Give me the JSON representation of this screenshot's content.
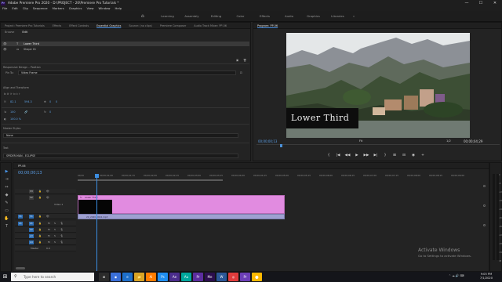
{
  "window": {
    "title": "Adobe Premiere Pro 2020 - D:\\PROJECT - 20\\Premiere Pro Tutorials *",
    "logo": "Pr",
    "controls": [
      "—",
      "☐",
      "✕"
    ]
  },
  "menu": [
    "File",
    "Edit",
    "Clip",
    "Sequence",
    "Markers",
    "Graphics",
    "View",
    "Window",
    "Help"
  ],
  "workspaces": [
    "Learning",
    "Assembly",
    "Editing",
    "Color",
    "Effects",
    "Audio",
    "Graphics",
    "Libraries",
    "»"
  ],
  "eg_panel": {
    "tabs": [
      "Project: Premiere Pro Tutorials",
      "Effects",
      "Effect Controls",
      "Essential Graphics",
      "Source: (no clips)",
      "Premiere Composer",
      "Audio Track Mixer: PP-06"
    ],
    "active_tab_index": 3,
    "subtabs": [
      "Browse",
      "Edit"
    ],
    "active_subtab_index": 1,
    "layers": [
      {
        "name": "Lower Third",
        "selected": true
      },
      {
        "name": "Shape 01",
        "selected": false
      }
    ],
    "responsive_label": "Responsive Design – Position",
    "pin_to_label": "Pin To:",
    "pin_to_value": "Video Frame",
    "align_label": "Align and Transform",
    "pos_x": "82.1",
    "pos_y": "594.3",
    "rot": "0",
    "scale": "100",
    "opacity_value": "100.0 %",
    "master_styles_label": "Master Styles",
    "master_styles_value": "None",
    "text_label": "Text",
    "font_value": "SPIDER-MAN - ECLIPSE"
  },
  "program": {
    "tab": "Program: PP-06",
    "overlay_text": "Lower Third",
    "timecode": "00;00;00;13",
    "fit": "Fit",
    "quality": "1/2",
    "duration": "00;00;04;29",
    "transport_icons": [
      "{",
      "|◀",
      "◀◀",
      "▶",
      "▶▶",
      "▶|",
      "}",
      "⊞",
      "⊟",
      "◉",
      "+"
    ]
  },
  "timeline": {
    "tab": "PP-06",
    "timecode": "00;00;00;13",
    "ruler": [
      "00;00",
      "00;00;01;00",
      "00;00;01;15",
      "00;00;02;00",
      "00;00;02;15",
      "00;00;03;00",
      "00;00;03;15",
      "00;00;04;00",
      "00;00;04;15",
      "00;00;05;00",
      "00;00;05;15",
      "00;00;06;00",
      "00;00;06;15",
      "00;00;07;00",
      "00;00;07;15",
      "00;00;08;00",
      "00;00;08;15",
      "00;00;09;00"
    ],
    "tracks": [
      "V3",
      "V2",
      "V1",
      "A1",
      "A2",
      "A3",
      "A4"
    ],
    "video_label": "Video 1",
    "master_label": "Master",
    "master_value": "0.0",
    "video_clip_fx": "fx",
    "video_clip_label": "Lower Third",
    "audio_clip_label": "20_2020-0024.mp3"
  },
  "tools": [
    "▶",
    "⇥",
    "↔",
    "◆",
    "✎",
    "▭",
    "✋",
    "T"
  ],
  "meters_labels": [
    "0",
    "-6",
    "-12",
    "-18",
    "-24",
    "-30",
    "-36",
    "-42",
    "-48",
    "-54",
    "dB"
  ],
  "activation": {
    "title": "Activate Windows",
    "subtitle": "Go to Settings to activate Windows."
  },
  "taskbar": {
    "search_placeholder": "Type here to search",
    "apps": [
      {
        "label": "⊞",
        "color": "#2b2b2b"
      },
      {
        "label": "◉",
        "color": "#3a6fd8"
      },
      {
        "label": "e",
        "color": "#1e6fc9"
      },
      {
        "label": "📁",
        "color": "#d8a324"
      },
      {
        "label": "Ai",
        "color": "#ff7c00"
      },
      {
        "label": "Ps",
        "color": "#1f8ef1"
      },
      {
        "label": "Ae",
        "color": "#4b2d8c"
      },
      {
        "label": "Au",
        "color": "#00a79d"
      },
      {
        "label": "Pr",
        "color": "#5b2d9e"
      },
      {
        "label": "Me",
        "color": "#2b0e4d"
      },
      {
        "label": "W",
        "color": "#2b5797"
      },
      {
        "label": "◎",
        "color": "#e03c3c"
      },
      {
        "label": "Pr",
        "color": "#6c3fb7"
      },
      {
        "label": "⬤",
        "color": "#ffb900"
      }
    ],
    "time": "9:05 PM",
    "date": "7/1/2020"
  }
}
